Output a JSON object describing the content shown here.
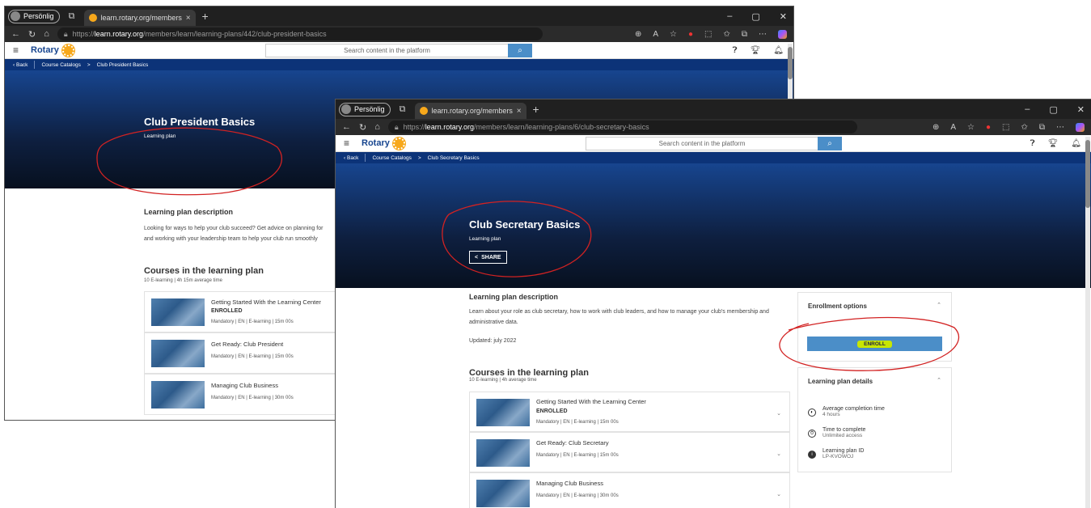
{
  "window1": {
    "tabbar": {
      "profile_label": "Persönlig",
      "tab_title": "learn.rotary.org/members/learn/le",
      "close": "×",
      "new_tab": "+"
    },
    "controls": {
      "minimize": "–",
      "maximize": "▢",
      "close": "✕"
    },
    "url": {
      "prefix": "https://",
      "host": "learn.rotary.org",
      "path": "/members/learn/learning-plans/442/club-president-basics"
    },
    "header": {
      "brand": "Rotary",
      "search_placeholder": "Search content in the platform"
    },
    "crumbs": {
      "back": "Back",
      "catalog": "Course Catalogs",
      "sep": ">",
      "current": "Club President Basics"
    },
    "hero": {
      "title": "Club President Basics",
      "subtitle": "Learning plan"
    },
    "description": {
      "heading": "Learning plan description",
      "line1": "Looking for ways to help your club succeed? Get advice on planning for",
      "line2": "and working with your leadership team to help your club run smoothly"
    },
    "courses": {
      "heading": "Courses in the learning plan",
      "meta": "10 E-learning | 4h 15m average time",
      "items": [
        {
          "name": "Getting Started With the Learning Center",
          "status": "ENROLLED",
          "info": "Mandatory | EN | E-learning | 15m 00s"
        },
        {
          "name": "Get Ready: Club President",
          "info": "Mandatory | EN | E-learning | 15m 00s"
        },
        {
          "name": "Managing Club Business",
          "info": "Mandatory | EN | E-learning | 30m 00s"
        }
      ]
    }
  },
  "window2": {
    "tabbar": {
      "profile_label": "Persönlig",
      "tab_title": "learn.rotary.org/members/learn/le",
      "close": "×",
      "new_tab": "+"
    },
    "controls": {
      "minimize": "–",
      "maximize": "▢",
      "close": "✕"
    },
    "url": {
      "prefix": "https://",
      "host": "learn.rotary.org",
      "path": "/members/learn/learning-plans/6/club-secretary-basics"
    },
    "header": {
      "brand": "Rotary",
      "search_placeholder": "Search content in the platform"
    },
    "crumbs": {
      "back": "Back",
      "catalog": "Course Catalogs",
      "sep": ">",
      "current": "Club Secretary Basics"
    },
    "hero": {
      "title": "Club Secretary Basics",
      "subtitle": "Learning plan",
      "share": "SHARE"
    },
    "description": {
      "heading": "Learning plan description",
      "line1": "Learn about your role as club secretary, how to work with club leaders, and how to manage your club's membership and",
      "line2": "administrative data.",
      "updated": "Updated: july 2022"
    },
    "courses": {
      "heading": "Courses in the learning plan",
      "meta": "10 E-learning | 4h average time",
      "items": [
        {
          "name": "Getting Started With the Learning Center",
          "status": "ENROLLED",
          "info": "Mandatory | EN | E-learning | 15m 00s"
        },
        {
          "name": "Get Ready: Club Secretary",
          "info": "Mandatory | EN | E-learning | 15m 00s"
        },
        {
          "name": "Managing Club Business",
          "info": "Mandatory | EN | E-learning | 30m 00s"
        }
      ]
    },
    "enrollment": {
      "heading": "Enrollment options",
      "button": "ENROLL"
    },
    "details": {
      "heading": "Learning plan details",
      "rows": [
        {
          "label": "Average completion time",
          "value": "4 hours"
        },
        {
          "label": "Time to complete",
          "value": "Unlimited access"
        },
        {
          "label": "Learning plan ID",
          "value": "LP-KVOWOJ"
        }
      ]
    }
  },
  "colors": {
    "rotary_blue": "#17458f",
    "rotary_gold": "#f7a81b",
    "annotation_red": "#d22222",
    "highlight": "#c8e600"
  }
}
